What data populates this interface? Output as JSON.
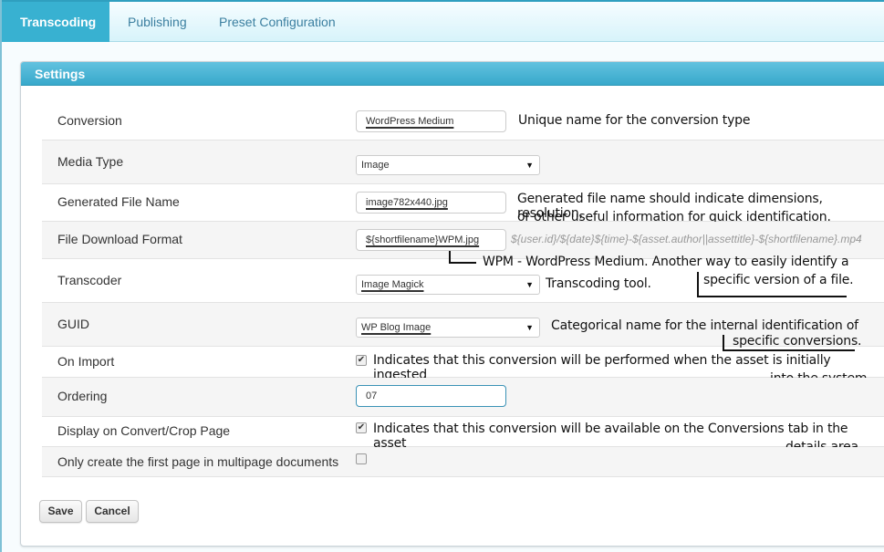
{
  "tabs": [
    {
      "label": "Transcoding",
      "active": true
    },
    {
      "label": "Publishing",
      "active": false
    },
    {
      "label": "Preset Configuration",
      "active": false
    }
  ],
  "panel": {
    "title": "Settings"
  },
  "fields": {
    "conversion": {
      "label": "Conversion",
      "value": "WordPress Medium",
      "note": "Unique name for the conversion type"
    },
    "media_type": {
      "label": "Media Type",
      "value": "Image"
    },
    "generated_file_name": {
      "label": "Generated File Name",
      "value": "image782x440.jpg",
      "note_line1": "Generated file name should indicate dimensions, resolution,",
      "note_line2": "or other useful information for quick identification."
    },
    "file_download_format": {
      "label": "File Download Format",
      "value": "${shortfilename}WPM.jpg",
      "hint": "${user.id}/${date}${time}-${asset.author||assettitle}-${shortfilename}.mp4",
      "note_line1": "WPM - WordPress Medium. Another way to easily identify a",
      "note_line2": "specific version of a file."
    },
    "transcoder": {
      "label": "Transcoder",
      "value": "Image Magick",
      "note": "Transcoding tool."
    },
    "guid": {
      "label": "GUID",
      "value": "WP Blog Image",
      "note_line1": "Categorical name for the internal identification of",
      "note_line2": "specific conversions."
    },
    "on_import": {
      "label": "On Import",
      "checked": true,
      "note_line1": "Indicates that this conversion will be performed when the asset is initially ingested",
      "note_line2": "into the system."
    },
    "ordering": {
      "label": "Ordering",
      "value": "07"
    },
    "display_on_convert": {
      "label": "Display on Convert/Crop Page",
      "checked": true,
      "note_line1": "Indicates that this conversion will be available on the Conversions tab in the asset",
      "note_line2": "details area."
    },
    "first_page_only": {
      "label": "Only create the first page in multipage documents",
      "checked": false
    }
  },
  "buttons": {
    "save": "Save",
    "cancel": "Cancel"
  },
  "icons": {
    "dropdown": "▼",
    "checkmark": "✔"
  }
}
